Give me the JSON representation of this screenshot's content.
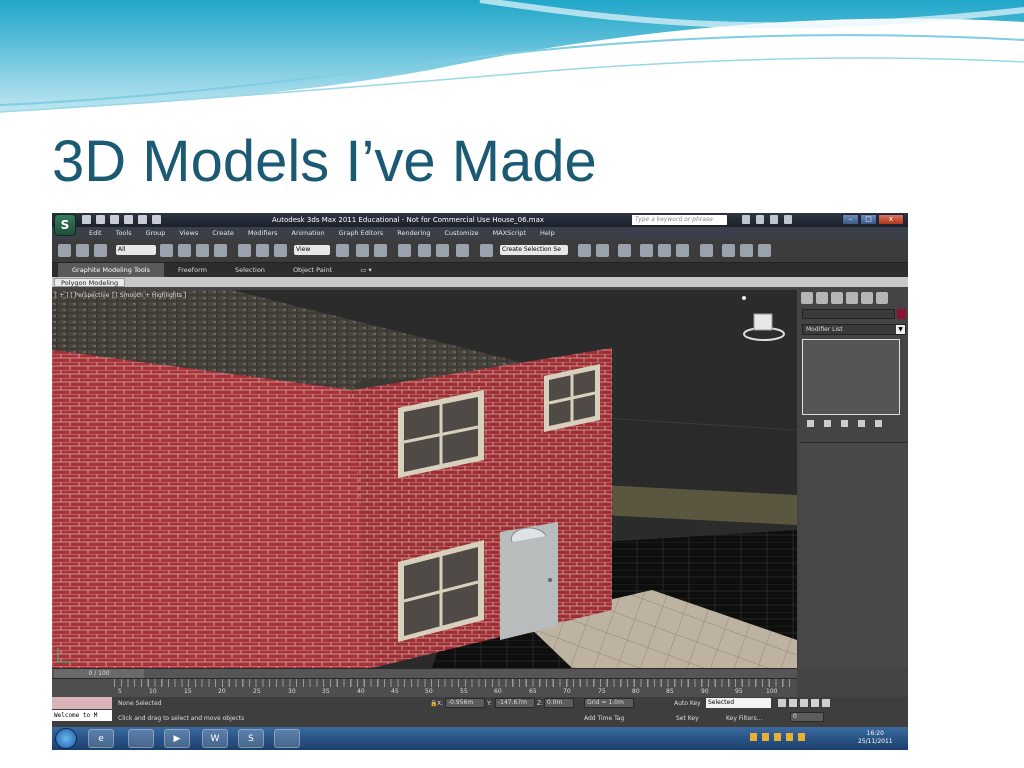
{
  "slide": {
    "title": "3D Models I’ve Made"
  },
  "app": {
    "window_title": "Autodesk 3ds Max  2011  Educational - Not for Commercial Use    House_06.max",
    "logo": "S",
    "search_placeholder": "Type a keyword or phrase",
    "menu": [
      "Edit",
      "Tools",
      "Group",
      "Views",
      "Create",
      "Modifiers",
      "Animation",
      "Graph Editors",
      "Rendering",
      "Customize",
      "MAXScript",
      "Help"
    ],
    "toolbar": {
      "filter_select": "All",
      "view_select": "View",
      "selection_set": "Create Selection Se"
    },
    "ribbon_tabs": [
      "Graphite Modeling Tools",
      "Freeform",
      "Selection",
      "Object Paint"
    ],
    "ribbon_panel": "Polygon Modeling",
    "viewport_label": "[ + ] [ Perspective ] [ Smooth + Highlights ]",
    "modifier_list": "Modifier List",
    "time_slider": "0 / 100",
    "track_ticks": [
      "5",
      "10",
      "15",
      "20",
      "25",
      "30",
      "35",
      "40",
      "45",
      "50",
      "55",
      "60",
      "65",
      "70",
      "75",
      "80",
      "85",
      "90",
      "95",
      "100"
    ],
    "status": {
      "selection": "None Selected",
      "prompt": "Click and drag to select and move objects",
      "welcome": "Welcome to M",
      "x": "-0.956m",
      "y": "-147.67m",
      "z": "0.0m",
      "grid": "Grid = 1.0m",
      "add_time_tag": "Add Time Tag",
      "auto_key": "Auto Key",
      "auto_key_value": "Selected",
      "set_key": "Set Key",
      "key_filters": "Key Filters...",
      "frame": "0"
    },
    "taskbar": {
      "time": "16:20",
      "date": "25/11/2011",
      "apps": [
        "e",
        "",
        "▶",
        "W",
        "S",
        ""
      ]
    }
  }
}
